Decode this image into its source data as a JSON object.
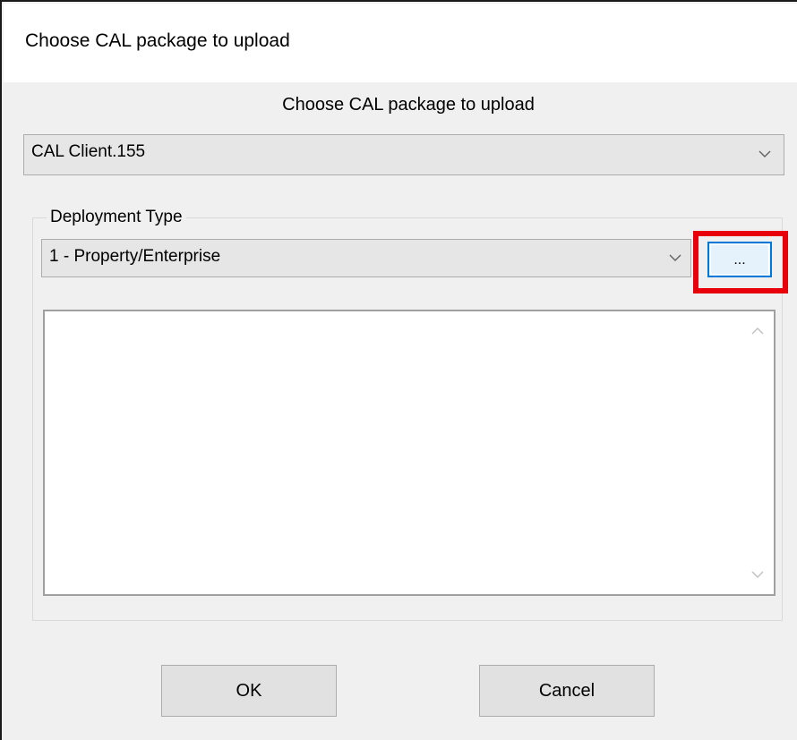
{
  "window": {
    "title": "Choose CAL package to upload"
  },
  "dialog": {
    "heading": "Choose CAL package to upload",
    "package_select": {
      "value": "CAL Client.155",
      "icon": "chevron-down-icon"
    },
    "deployment_group": {
      "label": "Deployment Type",
      "select": {
        "value": "1 - Property/Enterprise",
        "icon": "chevron-down-icon"
      },
      "browse_button": {
        "label": "...",
        "highlight_color": "#e8000a"
      },
      "details_textbox": {
        "value": "",
        "scroll_up_icon": "chevron-up-icon",
        "scroll_down_icon": "chevron-down-icon"
      }
    },
    "buttons": {
      "ok_label": "OK",
      "cancel_label": "Cancel"
    }
  },
  "colors": {
    "accent": "#0078d7",
    "highlight": "#e8000a",
    "background": "#f0f0f0"
  }
}
